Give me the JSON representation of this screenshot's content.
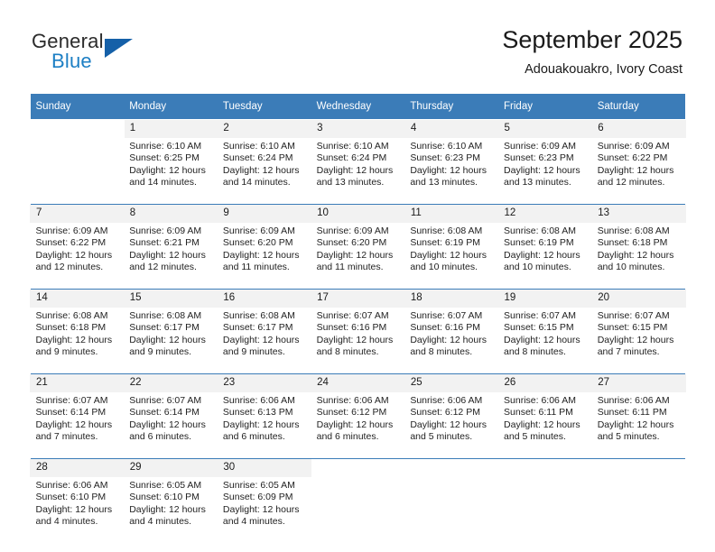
{
  "brand": {
    "word1": "General",
    "word2": "Blue",
    "triangle_color": "#1560a8",
    "blue_text_color": "#1d7fc4"
  },
  "header": {
    "title": "September 2025",
    "subtitle": "Adouakouakro, Ivory Coast"
  },
  "theme": {
    "header_bg": "#3b7cb8",
    "daynum_bg": "#f2f2f2",
    "separator": "#3b7cb8"
  },
  "weekday_headers": [
    "Sunday",
    "Monday",
    "Tuesday",
    "Wednesday",
    "Thursday",
    "Friday",
    "Saturday"
  ],
  "weeks": [
    [
      {
        "day": "",
        "sunrise": "",
        "sunset": "",
        "daylight1": "",
        "daylight2": ""
      },
      {
        "day": "1",
        "sunrise": "Sunrise: 6:10 AM",
        "sunset": "Sunset: 6:25 PM",
        "daylight1": "Daylight: 12 hours",
        "daylight2": "and 14 minutes."
      },
      {
        "day": "2",
        "sunrise": "Sunrise: 6:10 AM",
        "sunset": "Sunset: 6:24 PM",
        "daylight1": "Daylight: 12 hours",
        "daylight2": "and 14 minutes."
      },
      {
        "day": "3",
        "sunrise": "Sunrise: 6:10 AM",
        "sunset": "Sunset: 6:24 PM",
        "daylight1": "Daylight: 12 hours",
        "daylight2": "and 13 minutes."
      },
      {
        "day": "4",
        "sunrise": "Sunrise: 6:10 AM",
        "sunset": "Sunset: 6:23 PM",
        "daylight1": "Daylight: 12 hours",
        "daylight2": "and 13 minutes."
      },
      {
        "day": "5",
        "sunrise": "Sunrise: 6:09 AM",
        "sunset": "Sunset: 6:23 PM",
        "daylight1": "Daylight: 12 hours",
        "daylight2": "and 13 minutes."
      },
      {
        "day": "6",
        "sunrise": "Sunrise: 6:09 AM",
        "sunset": "Sunset: 6:22 PM",
        "daylight1": "Daylight: 12 hours",
        "daylight2": "and 12 minutes."
      }
    ],
    [
      {
        "day": "7",
        "sunrise": "Sunrise: 6:09 AM",
        "sunset": "Sunset: 6:22 PM",
        "daylight1": "Daylight: 12 hours",
        "daylight2": "and 12 minutes."
      },
      {
        "day": "8",
        "sunrise": "Sunrise: 6:09 AM",
        "sunset": "Sunset: 6:21 PM",
        "daylight1": "Daylight: 12 hours",
        "daylight2": "and 12 minutes."
      },
      {
        "day": "9",
        "sunrise": "Sunrise: 6:09 AM",
        "sunset": "Sunset: 6:20 PM",
        "daylight1": "Daylight: 12 hours",
        "daylight2": "and 11 minutes."
      },
      {
        "day": "10",
        "sunrise": "Sunrise: 6:09 AM",
        "sunset": "Sunset: 6:20 PM",
        "daylight1": "Daylight: 12 hours",
        "daylight2": "and 11 minutes."
      },
      {
        "day": "11",
        "sunrise": "Sunrise: 6:08 AM",
        "sunset": "Sunset: 6:19 PM",
        "daylight1": "Daylight: 12 hours",
        "daylight2": "and 10 minutes."
      },
      {
        "day": "12",
        "sunrise": "Sunrise: 6:08 AM",
        "sunset": "Sunset: 6:19 PM",
        "daylight1": "Daylight: 12 hours",
        "daylight2": "and 10 minutes."
      },
      {
        "day": "13",
        "sunrise": "Sunrise: 6:08 AM",
        "sunset": "Sunset: 6:18 PM",
        "daylight1": "Daylight: 12 hours",
        "daylight2": "and 10 minutes."
      }
    ],
    [
      {
        "day": "14",
        "sunrise": "Sunrise: 6:08 AM",
        "sunset": "Sunset: 6:18 PM",
        "daylight1": "Daylight: 12 hours",
        "daylight2": "and 9 minutes."
      },
      {
        "day": "15",
        "sunrise": "Sunrise: 6:08 AM",
        "sunset": "Sunset: 6:17 PM",
        "daylight1": "Daylight: 12 hours",
        "daylight2": "and 9 minutes."
      },
      {
        "day": "16",
        "sunrise": "Sunrise: 6:08 AM",
        "sunset": "Sunset: 6:17 PM",
        "daylight1": "Daylight: 12 hours",
        "daylight2": "and 9 minutes."
      },
      {
        "day": "17",
        "sunrise": "Sunrise: 6:07 AM",
        "sunset": "Sunset: 6:16 PM",
        "daylight1": "Daylight: 12 hours",
        "daylight2": "and 8 minutes."
      },
      {
        "day": "18",
        "sunrise": "Sunrise: 6:07 AM",
        "sunset": "Sunset: 6:16 PM",
        "daylight1": "Daylight: 12 hours",
        "daylight2": "and 8 minutes."
      },
      {
        "day": "19",
        "sunrise": "Sunrise: 6:07 AM",
        "sunset": "Sunset: 6:15 PM",
        "daylight1": "Daylight: 12 hours",
        "daylight2": "and 8 minutes."
      },
      {
        "day": "20",
        "sunrise": "Sunrise: 6:07 AM",
        "sunset": "Sunset: 6:15 PM",
        "daylight1": "Daylight: 12 hours",
        "daylight2": "and 7 minutes."
      }
    ],
    [
      {
        "day": "21",
        "sunrise": "Sunrise: 6:07 AM",
        "sunset": "Sunset: 6:14 PM",
        "daylight1": "Daylight: 12 hours",
        "daylight2": "and 7 minutes."
      },
      {
        "day": "22",
        "sunrise": "Sunrise: 6:07 AM",
        "sunset": "Sunset: 6:14 PM",
        "daylight1": "Daylight: 12 hours",
        "daylight2": "and 6 minutes."
      },
      {
        "day": "23",
        "sunrise": "Sunrise: 6:06 AM",
        "sunset": "Sunset: 6:13 PM",
        "daylight1": "Daylight: 12 hours",
        "daylight2": "and 6 minutes."
      },
      {
        "day": "24",
        "sunrise": "Sunrise: 6:06 AM",
        "sunset": "Sunset: 6:12 PM",
        "daylight1": "Daylight: 12 hours",
        "daylight2": "and 6 minutes."
      },
      {
        "day": "25",
        "sunrise": "Sunrise: 6:06 AM",
        "sunset": "Sunset: 6:12 PM",
        "daylight1": "Daylight: 12 hours",
        "daylight2": "and 5 minutes."
      },
      {
        "day": "26",
        "sunrise": "Sunrise: 6:06 AM",
        "sunset": "Sunset: 6:11 PM",
        "daylight1": "Daylight: 12 hours",
        "daylight2": "and 5 minutes."
      },
      {
        "day": "27",
        "sunrise": "Sunrise: 6:06 AM",
        "sunset": "Sunset: 6:11 PM",
        "daylight1": "Daylight: 12 hours",
        "daylight2": "and 5 minutes."
      }
    ],
    [
      {
        "day": "28",
        "sunrise": "Sunrise: 6:06 AM",
        "sunset": "Sunset: 6:10 PM",
        "daylight1": "Daylight: 12 hours",
        "daylight2": "and 4 minutes."
      },
      {
        "day": "29",
        "sunrise": "Sunrise: 6:05 AM",
        "sunset": "Sunset: 6:10 PM",
        "daylight1": "Daylight: 12 hours",
        "daylight2": "and 4 minutes."
      },
      {
        "day": "30",
        "sunrise": "Sunrise: 6:05 AM",
        "sunset": "Sunset: 6:09 PM",
        "daylight1": "Daylight: 12 hours",
        "daylight2": "and 4 minutes."
      },
      {
        "day": "",
        "sunrise": "",
        "sunset": "",
        "daylight1": "",
        "daylight2": ""
      },
      {
        "day": "",
        "sunrise": "",
        "sunset": "",
        "daylight1": "",
        "daylight2": ""
      },
      {
        "day": "",
        "sunrise": "",
        "sunset": "",
        "daylight1": "",
        "daylight2": ""
      },
      {
        "day": "",
        "sunrise": "",
        "sunset": "",
        "daylight1": "",
        "daylight2": ""
      }
    ]
  ]
}
